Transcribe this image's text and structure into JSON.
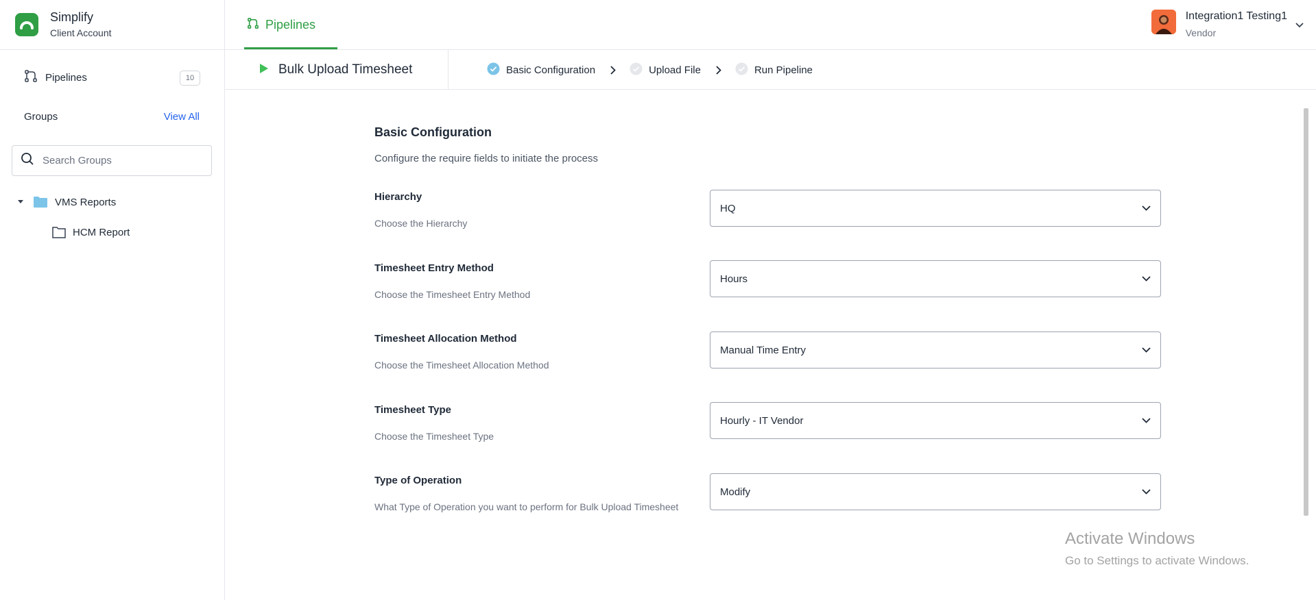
{
  "sidebar": {
    "brand_name": "Simplify",
    "brand_sub": "Client Account",
    "pipelines_label": "Pipelines",
    "pipelines_count": "10",
    "groups_title": "Groups",
    "view_all": "View All",
    "search_placeholder": "Search Groups",
    "tree": [
      {
        "label": "VMS Reports",
        "expanded": true,
        "icon": "folder-filled-icon"
      },
      {
        "label": "HCM Report",
        "icon": "folder-outline-icon"
      }
    ]
  },
  "topbar": {
    "tab_label": "Pipelines",
    "user_name": "Integration1 Testing1",
    "user_role": "Vendor"
  },
  "stepbar": {
    "title": "Bulk Upload Timesheet",
    "steps": [
      {
        "label": "Basic Configuration",
        "status": "done"
      },
      {
        "label": "Upload File",
        "status": "pending"
      },
      {
        "label": "Run Pipeline",
        "status": "pending"
      }
    ]
  },
  "form": {
    "title": "Basic Configuration",
    "subtitle": "Configure the require fields to initiate the process",
    "fields": [
      {
        "label": "Hierarchy",
        "hint": "Choose the Hierarchy",
        "value": "HQ"
      },
      {
        "label": "Timesheet Entry Method",
        "hint": "Choose the Timesheet Entry Method",
        "value": "Hours"
      },
      {
        "label": "Timesheet Allocation Method",
        "hint": "Choose the Timesheet Allocation Method",
        "value": "Manual Time Entry"
      },
      {
        "label": "Timesheet Type",
        "hint": "Choose the Timesheet Type",
        "value": "Hourly - IT Vendor"
      },
      {
        "label": "Type of Operation",
        "hint": "What Type of Operation you want to perform for Bulk Upload Timesheet",
        "value": "Modify"
      }
    ]
  },
  "watermark": {
    "line1": "Activate Windows",
    "line2": "Go to Settings to activate Windows."
  },
  "colors": {
    "accent": "#2f9e44",
    "link": "#2563eb",
    "step_done": "#7cc4e8",
    "step_pending": "#e5e7eb"
  }
}
